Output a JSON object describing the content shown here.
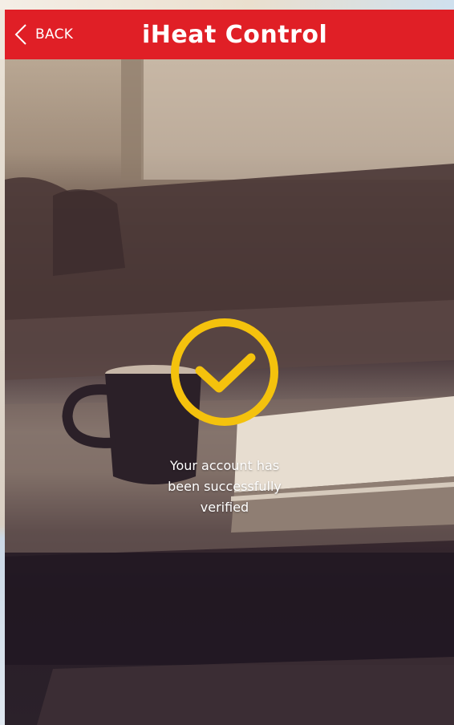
{
  "header": {
    "back_label": "BACK",
    "title": "iHeat Control",
    "background_color": "#e01f26"
  },
  "status": {
    "icon": "checkmark-circle-icon",
    "icon_color": "#f4c20d",
    "message_line1": "Your account has",
    "message_line2": "been successfully",
    "message_line3": "verified"
  }
}
